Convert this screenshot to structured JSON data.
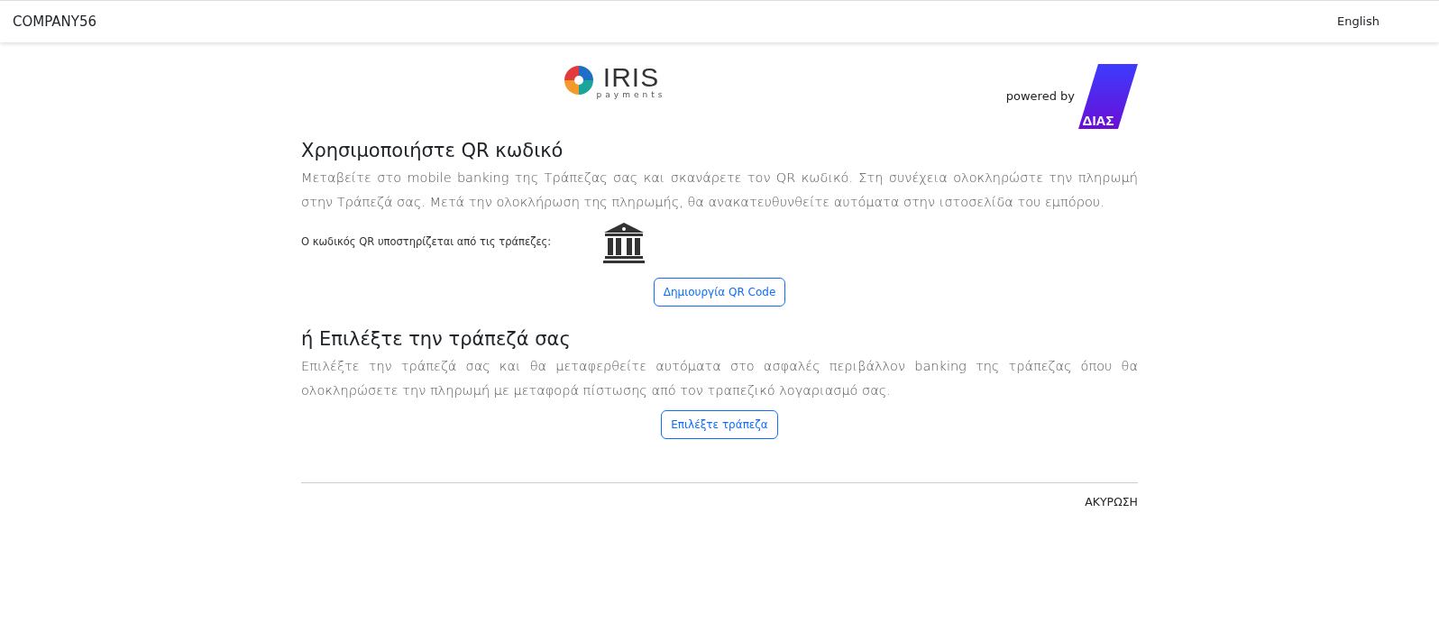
{
  "navbar": {
    "brand": "COMPANY56",
    "language": "English"
  },
  "logos": {
    "iris_name": "IRIS",
    "iris_sub": "payments",
    "powered_by": "powered by",
    "dias": "ΔΙΑΣ"
  },
  "qr_section": {
    "title": "Χρησιμοποιήστε QR κωδικό",
    "text": "Μεταβείτε στο mobile banking της Τράπεζας σας και σκανάρετε τον QR κωδικό. Στη συνέχεια ολοκληρώστε την πληρωμή στην Τράπεζά σας. Μετά την ολοκλήρωση της πληρωμής, θα ανακατευθυνθείτε αυτόματα στην ιστοσελίδα του εμπόρου.",
    "supported_label": "Ο κωδικός QR υποστηρίζεται από τις τράπεζες:",
    "button": "Δημιουργία QR Code"
  },
  "bank_section": {
    "title": "ή Επιλέξτε την τράπεζά σας",
    "text": "Επιλέξτε την τράπεζά σας και θα μεταφερθείτε αυτόματα στο ασφαλές περιβάλλον banking της τράπεζας όπου θα ολοκληρώσετε την πληρωμή με μεταφορά πίστωσης από τον τραπεζικό λογαριασμό σας.",
    "button": "Επιλέξτε τράπεζα"
  },
  "footer": {
    "cancel": "ΑΚΥΡΩΣΗ"
  }
}
